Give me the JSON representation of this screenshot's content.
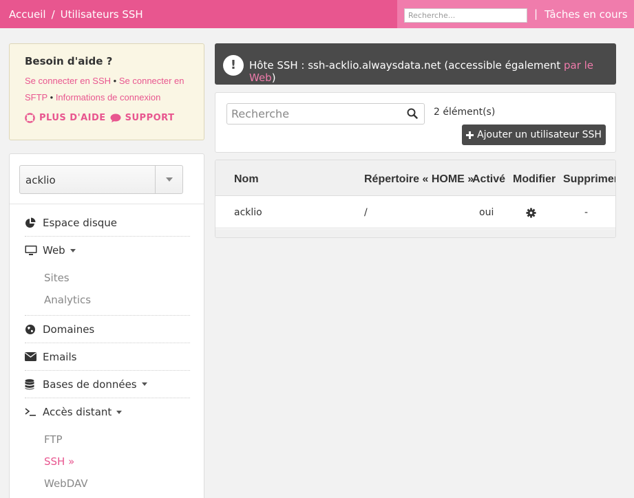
{
  "topbar": {
    "breadcrumb": [
      "Accueil",
      "/",
      "Utilisateurs SSH"
    ],
    "search_placeholder": "Recherche...",
    "separator": "|",
    "tasks_label": "Tâches en cours"
  },
  "help": {
    "title": "Besoin d'aide ?",
    "link_ssh": "Se connecter en SSH",
    "bullet": "•",
    "link_sftp_part1": "Se connecter en",
    "link_sftp_part2": "SFTP",
    "link_info": "Informations de connexion",
    "more_help": "PLUS D'AIDE",
    "support": "SUPPORT"
  },
  "account": {
    "selected": "acklio"
  },
  "nav": {
    "disk": "Espace disque",
    "web": "Web",
    "web_sub": [
      "Sites",
      "Analytics"
    ],
    "domains": "Domaines",
    "emails": "Emails",
    "databases": "Bases de données",
    "remote": "Accès distant",
    "remote_sub": [
      "FTP",
      "SSH »",
      "WebDAV"
    ]
  },
  "info": {
    "icon_text": "!",
    "text": "Hôte SSH : ssh-acklio.alwaysdata.net (accessible également ",
    "link": "par le Web",
    "text_end": ")"
  },
  "toolbar": {
    "search_placeholder": "Recherche",
    "count": "2 élément(s)",
    "add_label": "Ajouter un utilisateur SSH"
  },
  "table": {
    "headers": [
      "Nom",
      "Répertoire « HOME »",
      "Activé",
      "Modifier",
      "Supprimer"
    ],
    "rows": [
      {
        "name": "acklio",
        "home": "/",
        "active": "oui",
        "delete": "-"
      }
    ]
  },
  "colors": {
    "brand": "#e8568f",
    "dark": "#4a4a4a"
  }
}
